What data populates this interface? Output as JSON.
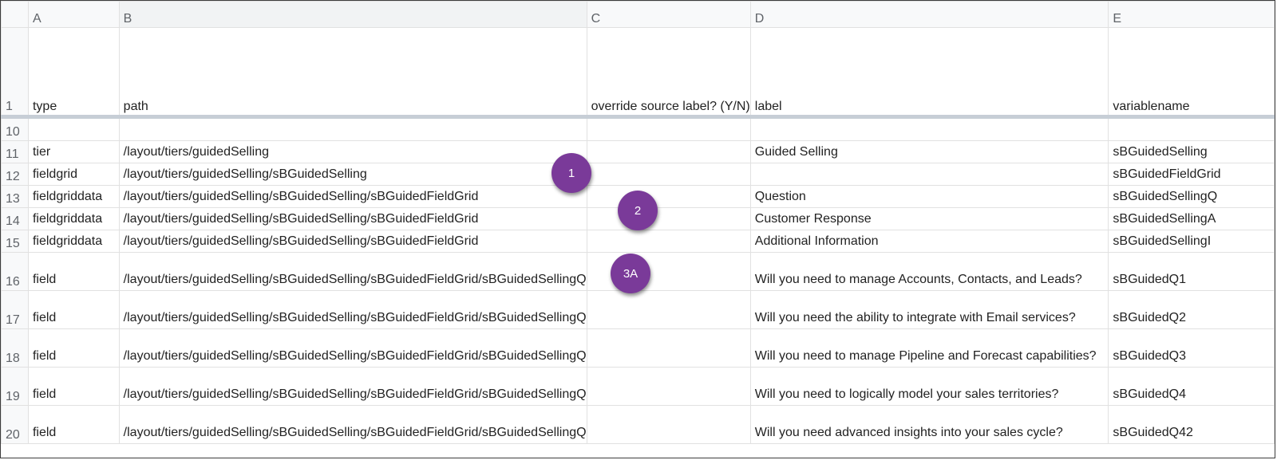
{
  "columns": [
    "A",
    "B",
    "C",
    "D",
    "E"
  ],
  "header_row": {
    "number": "1",
    "cells": [
      "type",
      "path",
      "override source label? (Y/N)",
      "label",
      "variablename"
    ]
  },
  "rows": [
    {
      "number": "10",
      "cells": [
        "",
        "",
        "",
        "",
        ""
      ]
    },
    {
      "number": "11",
      "cells": [
        "tier",
        "/layout/tiers/guidedSelling",
        "",
        "Guided Selling",
        "sBGuidedSelling"
      ]
    },
    {
      "number": "12",
      "cells": [
        "fieldgrid",
        "/layout/tiers/guidedSelling/sBGuidedSelling",
        "",
        "",
        "sBGuidedFieldGrid"
      ]
    },
    {
      "number": "13",
      "cells": [
        "fieldgriddata",
        "/layout/tiers/guidedSelling/sBGuidedSelling/sBGuidedFieldGrid",
        "",
        "Question",
        "sBGuidedSellingQ"
      ]
    },
    {
      "number": "14",
      "cells": [
        "fieldgriddata",
        "/layout/tiers/guidedSelling/sBGuidedSelling/sBGuidedFieldGrid",
        "",
        "Customer Response",
        "sBGuidedSellingA"
      ]
    },
    {
      "number": "15",
      "cells": [
        "fieldgriddata",
        "/layout/tiers/guidedSelling/sBGuidedSelling/sBGuidedFieldGrid",
        "",
        "Additional Information",
        "sBGuidedSellingI"
      ]
    },
    {
      "number": "16",
      "cells": [
        "field",
        "/layout/tiers/guidedSelling/sBGuidedSelling/sBGuidedFieldGrid/sBGuidedSellingQ",
        "",
        "Will you need to manage Accounts, Contacts, and Leads?",
        "sBGuidedQ1"
      ]
    },
    {
      "number": "17",
      "cells": [
        "field",
        "/layout/tiers/guidedSelling/sBGuidedSelling/sBGuidedFieldGrid/sBGuidedSellingQ",
        "",
        "Will you need the ability to integrate with Email services?",
        "sBGuidedQ2"
      ]
    },
    {
      "number": "18",
      "cells": [
        "field",
        "/layout/tiers/guidedSelling/sBGuidedSelling/sBGuidedFieldGrid/sBGuidedSellingQ",
        "",
        "Will you need to manage Pipeline and Forecast capabilities?",
        "sBGuidedQ3"
      ]
    },
    {
      "number": "19",
      "cells": [
        "field",
        "/layout/tiers/guidedSelling/sBGuidedSelling/sBGuidedFieldGrid/sBGuidedSellingQ",
        "",
        "Will you need to logically model your sales territories?",
        "sBGuidedQ4"
      ]
    },
    {
      "number": "20",
      "cells": [
        "field",
        "/layout/tiers/guidedSelling/sBGuidedSelling/sBGuidedFieldGrid/sBGuidedSellingQ",
        "",
        "Will you need advanced insights into your sales cycle?",
        "sBGuidedQ42"
      ]
    }
  ],
  "callouts": [
    "1",
    "2",
    "3A"
  ],
  "colors": {
    "callout": "#7a3a99",
    "header_bg": "#f8f9fa",
    "freeze_line": "#c7ced6",
    "grid": "#e1e1e1"
  }
}
